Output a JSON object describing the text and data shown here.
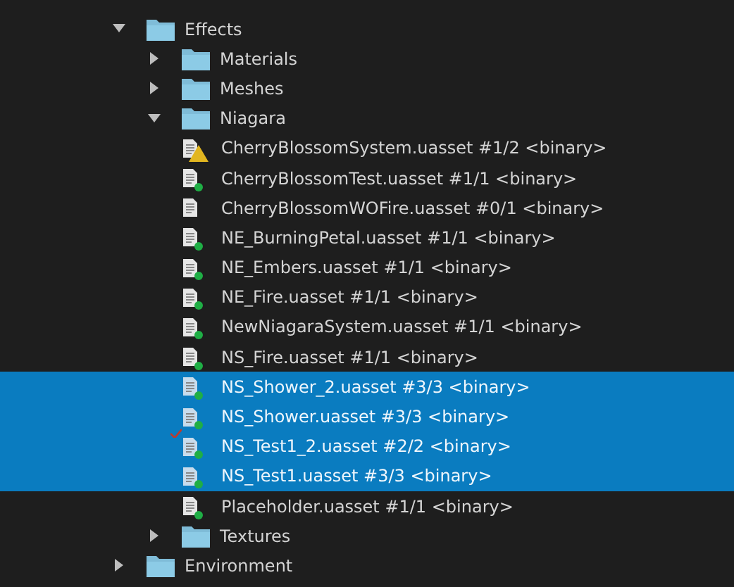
{
  "tree": [
    {
      "kind": "folder",
      "label": "Effects",
      "expanded": true,
      "children": [
        {
          "kind": "folder",
          "label": "Materials",
          "expanded": false
        },
        {
          "kind": "folder",
          "label": "Meshes",
          "expanded": false
        },
        {
          "kind": "folder",
          "label": "Niagara",
          "expanded": true,
          "children": [
            {
              "kind": "file",
              "label": "CherryBlossomSystem.uasset #1/2 <binary>",
              "warning": true,
              "synced": false,
              "checked_out": false,
              "selected": false
            },
            {
              "kind": "file",
              "label": "CherryBlossomTest.uasset #1/1 <binary>",
              "warning": false,
              "synced": true,
              "checked_out": false,
              "selected": false
            },
            {
              "kind": "file",
              "label": "CherryBlossomWOFire.uasset #0/1 <binary>",
              "warning": false,
              "synced": false,
              "checked_out": false,
              "selected": false
            },
            {
              "kind": "file",
              "label": "NE_BurningPetal.uasset #1/1 <binary>",
              "warning": false,
              "synced": true,
              "checked_out": false,
              "selected": false
            },
            {
              "kind": "file",
              "label": "NE_Embers.uasset #1/1 <binary>",
              "warning": false,
              "synced": true,
              "checked_out": false,
              "selected": false
            },
            {
              "kind": "file",
              "label": "NE_Fire.uasset #1/1 <binary>",
              "warning": false,
              "synced": true,
              "checked_out": false,
              "selected": false
            },
            {
              "kind": "file",
              "label": "NewNiagaraSystem.uasset #1/1 <binary>",
              "warning": false,
              "synced": true,
              "checked_out": false,
              "selected": false
            },
            {
              "kind": "file",
              "label": "NS_Fire.uasset #1/1 <binary>",
              "warning": false,
              "synced": true,
              "checked_out": false,
              "selected": false
            },
            {
              "kind": "file",
              "label": "NS_Shower_2.uasset #3/3 <binary>",
              "warning": false,
              "synced": true,
              "checked_out": false,
              "selected": true
            },
            {
              "kind": "file",
              "label": "NS_Shower.uasset #3/3 <binary>",
              "warning": false,
              "synced": true,
              "checked_out": false,
              "selected": true
            },
            {
              "kind": "file",
              "label": "NS_Test1_2.uasset #2/2 <binary>",
              "warning": false,
              "synced": true,
              "checked_out": true,
              "selected": true
            },
            {
              "kind": "file",
              "label": "NS_Test1.uasset #3/3 <binary>",
              "warning": false,
              "synced": true,
              "checked_out": false,
              "selected": true
            },
            {
              "kind": "file",
              "label": "Placeholder.uasset #1/1 <binary>",
              "warning": false,
              "synced": true,
              "checked_out": false,
              "selected": false
            }
          ]
        },
        {
          "kind": "folder",
          "label": "Textures",
          "expanded": false
        }
      ]
    },
    {
      "kind": "folder",
      "label": "Environment",
      "expanded": false
    }
  ]
}
